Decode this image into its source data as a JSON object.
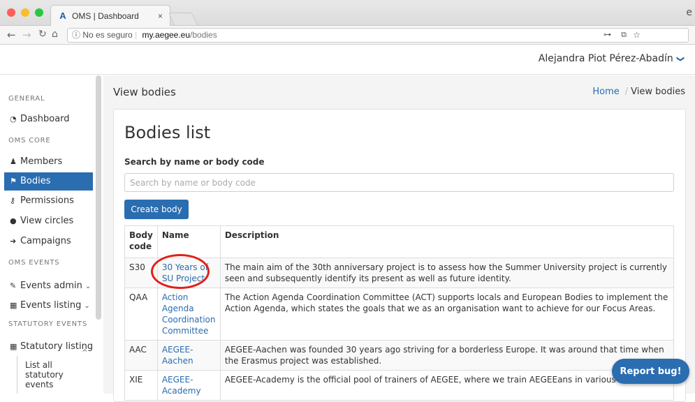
{
  "browser": {
    "tab_title": "OMS | Dashboard",
    "tab_close": "×",
    "insecure_label": "ⓘ No es seguro",
    "url_host": "my.aegee.eu",
    "url_path": "/bodies"
  },
  "header": {
    "user_name": "Alejandra Piot Pérez-Abadín",
    "user_chevron": "❯"
  },
  "sidebar": {
    "sections": {
      "general": "GENERAL",
      "oms_core": "OMS CORE",
      "oms_events": "OMS EVENTS",
      "statutory_events": "STATUTORY EVENTS"
    },
    "items": [
      {
        "label": "Dashboard",
        "icon": "dashboard-icon"
      },
      {
        "label": "Members",
        "icon": "user-icon"
      },
      {
        "label": "Bodies",
        "icon": "flag-icon"
      },
      {
        "label": "Permissions",
        "icon": "key-icon"
      },
      {
        "label": "View circles",
        "icon": "circle-icon"
      },
      {
        "label": "Campaigns",
        "icon": "sign-in-icon"
      },
      {
        "label": "Events admin",
        "icon": "wrench-icon"
      },
      {
        "label": "Events listing",
        "icon": "calendar-icon"
      },
      {
        "label": "Statutory listing",
        "icon": "calendar-icon"
      }
    ],
    "sub_item": "List all statutory events"
  },
  "main": {
    "page_title": "View bodies",
    "breadcrumb": {
      "home": "Home",
      "separator": "/",
      "current": "View bodies"
    },
    "card_title": "Bodies list",
    "search_label": "Search by name or body code",
    "search_placeholder": "Search by name or body code",
    "create_button": "Create body",
    "table": {
      "headers": {
        "code": "Body code",
        "name": "Name",
        "description": "Description"
      },
      "rows": [
        {
          "code": "S30",
          "name": "30 Years of SU Project",
          "description": "The main aim of the 30th anniversary project is to assess how the Summer University project is currently seen and subsequently identify its present as well as future identity."
        },
        {
          "code": "QAA",
          "name": "Action Agenda Coordination Committee",
          "description": "The Action Agenda Coordination Committee (ACT) supports locals and European Bodies to implement the Action Agenda, which states the goals that we as an organisation want to achieve for our Focus Areas."
        },
        {
          "code": "AAC",
          "name": "AEGEE-Aachen",
          "description": "AEGEE-Aachen was founded 30 years ago striving for a borderless Europe. It was around that time when the Erasmus project was established."
        },
        {
          "code": "XIE",
          "name": "AEGEE-Academy",
          "description": "AEGEE-Academy is the official pool of trainers of AEGEE, where we train AEGEEans in various skills that"
        }
      ]
    }
  },
  "report_button": "Report bug!",
  "colors": {
    "accent": "#2a6db0",
    "highlight_circle": "#e0201b"
  }
}
